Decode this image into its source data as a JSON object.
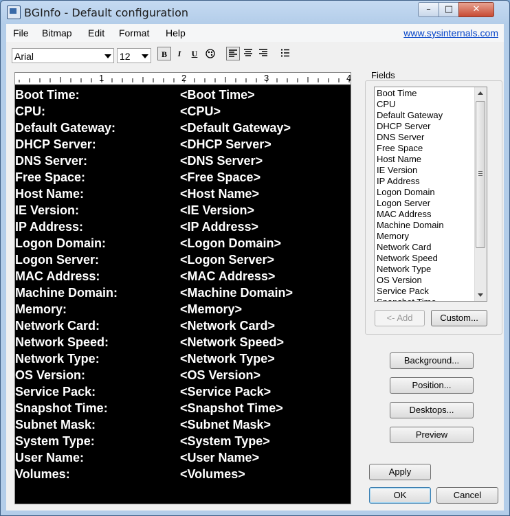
{
  "window": {
    "title": "BGInfo - Default configuration"
  },
  "menu": {
    "items": [
      "File",
      "Bitmap",
      "Edit",
      "Format",
      "Help"
    ],
    "link": "www.sysinternals.com"
  },
  "toolbar": {
    "font": "Arial",
    "size": "12",
    "bold_label": "B",
    "italic_label": "I",
    "underline_label": "U"
  },
  "ruler": {
    "numbers": [
      "1",
      "2",
      "3",
      "4"
    ]
  },
  "editor": {
    "background": "#000000",
    "text_color": "#ffffff",
    "rows": [
      {
        "label": "Boot Time:",
        "value": "<Boot Time>"
      },
      {
        "label": "CPU:",
        "value": "<CPU>"
      },
      {
        "label": "Default Gateway:",
        "value": "<Default Gateway>"
      },
      {
        "label": "DHCP Server:",
        "value": "<DHCP Server>"
      },
      {
        "label": "DNS Server:",
        "value": "<DNS Server>"
      },
      {
        "label": "Free Space:",
        "value": "<Free Space>"
      },
      {
        "label": "Host Name:",
        "value": "<Host Name>"
      },
      {
        "label": "IE Version:",
        "value": "<IE Version>"
      },
      {
        "label": "IP Address:",
        "value": "<IP Address>"
      },
      {
        "label": "Logon Domain:",
        "value": "<Logon Domain>"
      },
      {
        "label": "Logon Server:",
        "value": "<Logon Server>"
      },
      {
        "label": "MAC Address:",
        "value": "<MAC Address>"
      },
      {
        "label": "Machine Domain:",
        "value": "<Machine Domain>"
      },
      {
        "label": "Memory:",
        "value": "<Memory>"
      },
      {
        "label": "Network Card:",
        "value": "<Network Card>"
      },
      {
        "label": "Network Speed:",
        "value": "<Network Speed>"
      },
      {
        "label": "Network Type:",
        "value": "<Network Type>"
      },
      {
        "label": "OS Version:",
        "value": "<OS Version>"
      },
      {
        "label": "Service Pack:",
        "value": "<Service Pack>"
      },
      {
        "label": "Snapshot Time:",
        "value": "<Snapshot Time>"
      },
      {
        "label": "Subnet Mask:",
        "value": "<Subnet Mask>"
      },
      {
        "label": "System Type:",
        "value": "<System Type>"
      },
      {
        "label": "User Name:",
        "value": "<User Name>"
      },
      {
        "label": "Volumes:",
        "value": "<Volumes>"
      }
    ]
  },
  "fields": {
    "label": "Fields",
    "items": [
      "Boot Time",
      "CPU",
      "Default Gateway",
      "DHCP Server",
      "DNS Server",
      "Free Space",
      "Host Name",
      "IE Version",
      "IP Address",
      "Logon Domain",
      "Logon Server",
      "MAC Address",
      "Machine Domain",
      "Memory",
      "Network Card",
      "Network Speed",
      "Network Type",
      "OS Version",
      "Service Pack",
      "Snapshot Time"
    ],
    "add_label": "<- Add",
    "custom_label": "Custom..."
  },
  "buttons": {
    "background": "Background...",
    "position": "Position...",
    "desktops": "Desktops...",
    "preview": "Preview",
    "apply": "Apply",
    "ok": "OK",
    "cancel": "Cancel"
  }
}
